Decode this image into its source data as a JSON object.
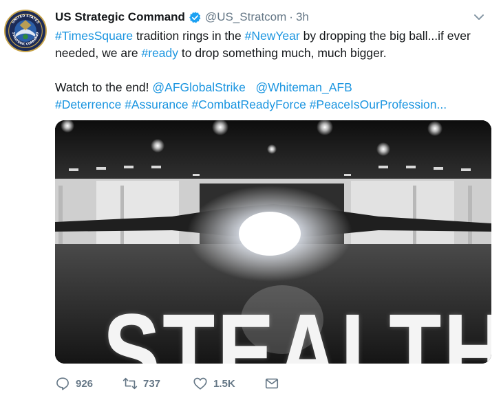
{
  "author": {
    "name": "US Strategic Command",
    "handle": "@US_Stratcom",
    "separator": "·",
    "time": "3h",
    "avatar_seal_text": "UNITED STATES STRATEGIC COMMAND"
  },
  "tweet": {
    "line1": {
      "tag1": "#TimesSquare",
      "t1": " tradition rings in the ",
      "tag2": "#NewYear",
      "t2": " by dropping the big ball...if ever"
    },
    "line2": {
      "t1": "needed, we are ",
      "tag": "#ready",
      "t2": " to drop something much, much bigger."
    },
    "line3": {
      "t1": "Watch to the end! ",
      "mention1": "@AFGlobalStrike",
      "mention2": "@Whiteman_AFB"
    },
    "line4": {
      "tag1": "#Deterrence",
      "tag2": "#Assurance",
      "tag3": "#CombatReadyForce",
      "tag4": "#PeaceIsOurProfession",
      "ellipsis": "..."
    }
  },
  "media": {
    "overlay_text": "STEALTH"
  },
  "actions": {
    "replies": "926",
    "retweets": "737",
    "likes": "1.5K"
  },
  "colors": {
    "link": "#1b95e0",
    "secondary": "#657786",
    "verified": "#1da1f2"
  },
  "icons": {
    "verified": "verified-badge-icon",
    "caret": "chevron-down-icon",
    "reply": "reply-icon",
    "retweet": "retweet-icon",
    "like": "heart-icon",
    "dm": "envelope-icon"
  }
}
